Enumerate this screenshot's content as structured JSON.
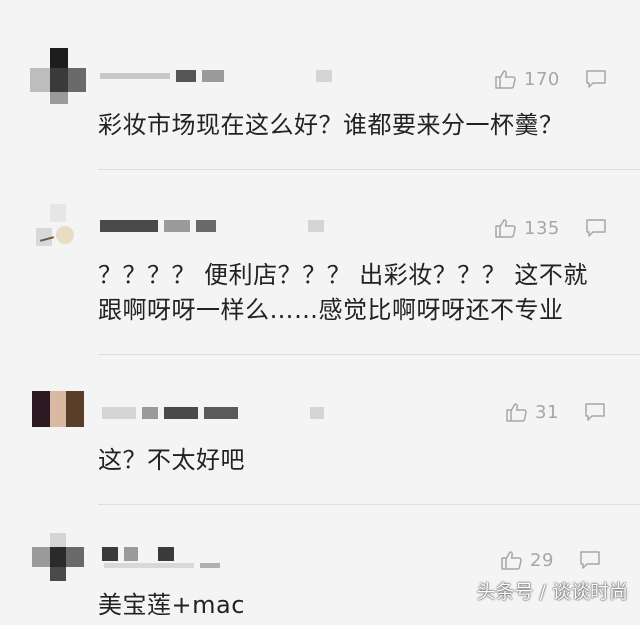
{
  "comments": [
    {
      "likes": "170",
      "text": "彩妆市场现在这么好？谁都要来分一杯羹？"
    },
    {
      "likes": "135",
      "text": "？？？？ 便利店？？？ 出彩妆？？？ 这不就",
      "text2": "跟啊呀呀一样么……感觉比啊呀呀还不专业"
    },
    {
      "likes": "31",
      "text": "这？不太好吧"
    },
    {
      "likes": "29",
      "text": "美宝莲+mac"
    }
  ],
  "icons": {
    "like": "thumbs-up-icon",
    "reply": "reply-bubble-icon"
  },
  "colors": {
    "background": "#f4f4f4",
    "text": "#222222",
    "meta": "#a7a7a7"
  },
  "watermark": "头条号 / 谈谈时尚"
}
